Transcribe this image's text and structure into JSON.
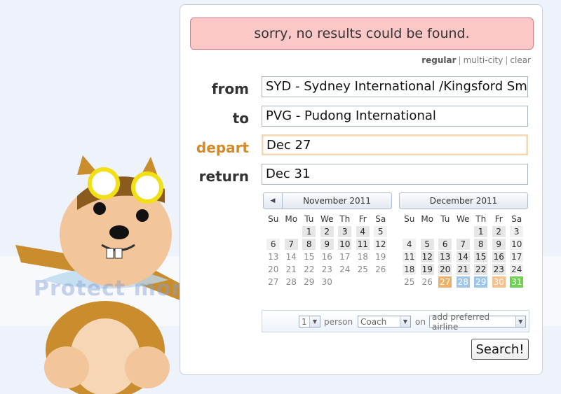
{
  "error": {
    "message": "sorry, no results could be found."
  },
  "mode_links": {
    "regular": "regular",
    "multi_city": "multi-city",
    "clear": "clear",
    "separator": "|"
  },
  "form": {
    "from": {
      "label": "from",
      "value": "SYD - Sydney International /Kingsford Smith"
    },
    "to": {
      "label": "to",
      "value": "PVG - Pudong International"
    },
    "depart": {
      "label": "depart",
      "value": "Dec 27"
    },
    "return": {
      "label": "return",
      "value": "Dec 31"
    }
  },
  "calendars": [
    {
      "title": "November 2011",
      "nav_icon": "prev-arrow-icon",
      "dows": [
        "Su",
        "Mo",
        "Tu",
        "We",
        "Th",
        "Fr",
        "Sa"
      ],
      "offset": 2,
      "days": 30,
      "past_until": 12,
      "selections": {}
    },
    {
      "title": "December 2011",
      "nav_icon": "",
      "dows": [
        "Su",
        "Mo",
        "Tu",
        "We",
        "Th",
        "Fr",
        "Sa"
      ],
      "offset": 4,
      "days": 31,
      "past_until": 0,
      "selections": {
        "27": "sel-orange",
        "28": "sel-blue",
        "29": "sel-blue",
        "30": "sel-peach",
        "31": "sel-green"
      }
    }
  ],
  "options": {
    "passengers": "1",
    "person_label": "person",
    "cabin": "Coach",
    "on_label": "on",
    "airline_placeholder": "add preferred airline"
  },
  "search_button": "Search!",
  "watermark": "Protect more",
  "colors": {
    "error_bg": "#fcc7c7",
    "active_label": "#d48a2a",
    "mascot_fur": "#c98d2e",
    "goggles": "#f1e015"
  }
}
